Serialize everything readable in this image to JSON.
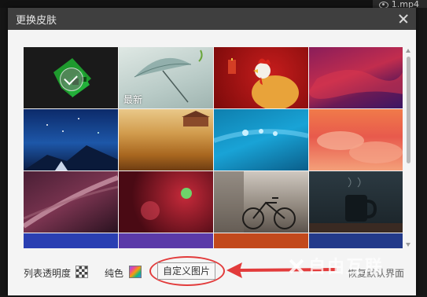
{
  "background": {
    "file_label": "1.mp4",
    "file_icon": "eye-icon"
  },
  "dialog": {
    "title": "更换皮肤",
    "close_icon": "close-icon"
  },
  "skins": [
    {
      "name": "green-film",
      "selected": true,
      "tag": ""
    },
    {
      "name": "umbrella",
      "selected": false,
      "tag": "最新"
    },
    {
      "name": "rooster",
      "selected": false,
      "tag": ""
    },
    {
      "name": "red-abstract",
      "selected": false,
      "tag": ""
    },
    {
      "name": "night-sky",
      "selected": false,
      "tag": ""
    },
    {
      "name": "wheat-field",
      "selected": false,
      "tag": ""
    },
    {
      "name": "water-drops",
      "selected": false,
      "tag": ""
    },
    {
      "name": "pink-clouds",
      "selected": false,
      "tag": ""
    },
    {
      "name": "leaf-closeup",
      "selected": false,
      "tag": ""
    },
    {
      "name": "red-bokeh",
      "selected": false,
      "tag": ""
    },
    {
      "name": "bicycle",
      "selected": false,
      "tag": ""
    },
    {
      "name": "coffee-cup",
      "selected": false,
      "tag": ""
    },
    {
      "name": "blue-partial",
      "selected": false,
      "tag": ""
    },
    {
      "name": "purple-partial",
      "selected": false,
      "tag": ""
    },
    {
      "name": "orange-partial",
      "selected": false,
      "tag": ""
    },
    {
      "name": "dark-blue-partial",
      "selected": false,
      "tag": ""
    }
  ],
  "footer": {
    "opacity_label": "列表透明度",
    "opacity_icon": "checkerboard-icon",
    "solid_label": "纯色",
    "solid_icon": "color-swatch-icon",
    "custom_button": "自定义图片",
    "restore_label": "恢复默认界面"
  },
  "annotation": {
    "ellipse_color": "#e23b3b",
    "arrow_color": "#e23b3b"
  },
  "watermark": "自由互联",
  "colors": {
    "titlebar": "#3f3f3f",
    "dialog_bg": "#f4f4f4"
  }
}
